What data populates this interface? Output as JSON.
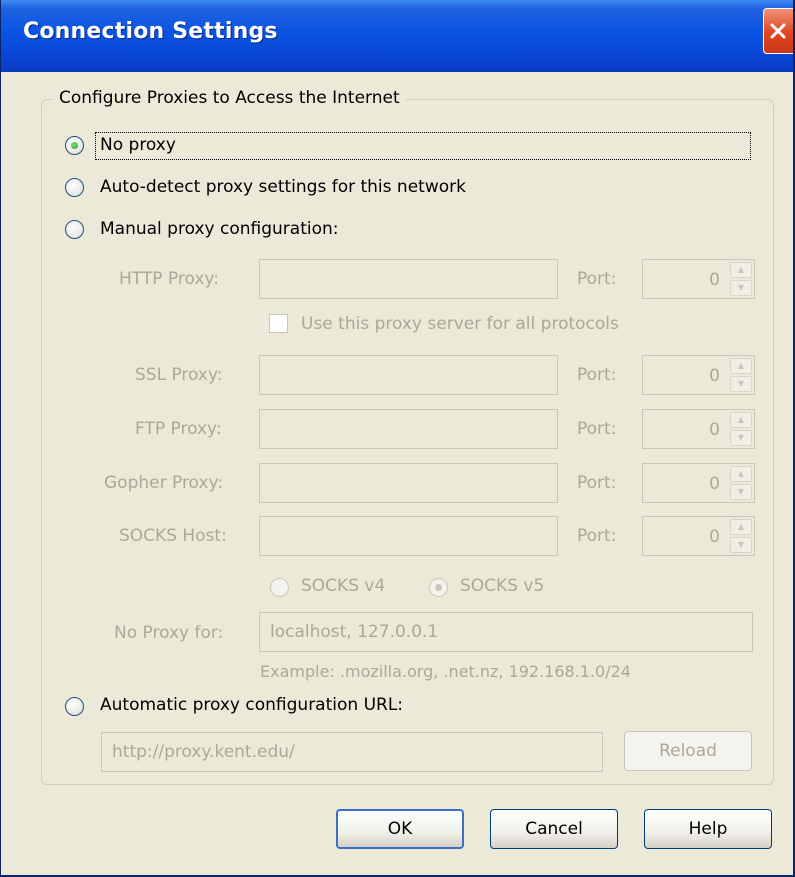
{
  "window": {
    "title": "Connection Settings"
  },
  "group": {
    "legend": "Configure Proxies to Access the Internet"
  },
  "options": {
    "no_proxy": "No proxy",
    "auto_detect": "Auto-detect proxy settings for this network",
    "manual": "Manual proxy configuration:",
    "auto_url": "Automatic proxy configuration URL:"
  },
  "manual": {
    "http_label": "HTTP Proxy:",
    "ssl_label": "SSL Proxy:",
    "ftp_label": "FTP Proxy:",
    "gopher_label": "Gopher Proxy:",
    "socks_label": "SOCKS Host:",
    "port_label": "Port:",
    "http_port": "0",
    "ssl_port": "0",
    "ftp_port": "0",
    "gopher_port": "0",
    "socks_port": "0",
    "use_same": "Use this proxy server for all protocols",
    "socks_v4": "SOCKS v4",
    "socks_v5": "SOCKS v5",
    "no_proxy_label": "No Proxy for:",
    "no_proxy_value": "localhost, 127.0.0.1",
    "example": "Example: .mozilla.org, .net.nz, 192.168.1.0/24"
  },
  "auto": {
    "url": "http://proxy.kent.edu/",
    "reload": "Reload"
  },
  "buttons": {
    "ok": "OK",
    "cancel": "Cancel",
    "help": "Help"
  }
}
